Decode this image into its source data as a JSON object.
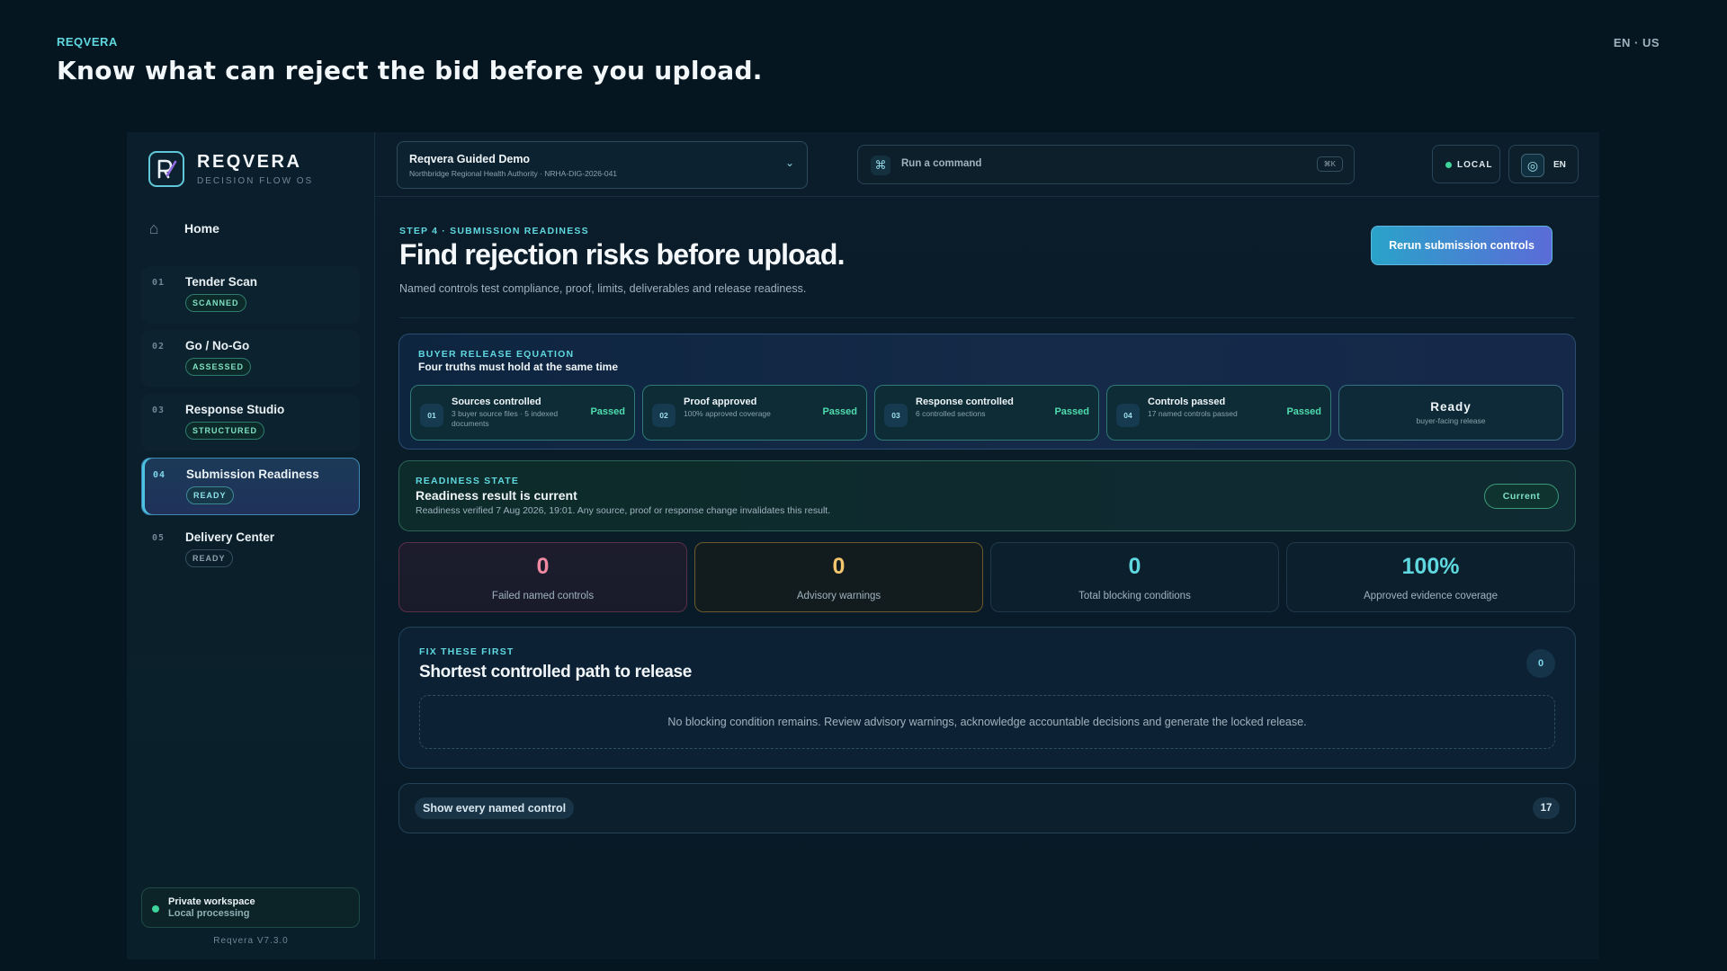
{
  "outer": {
    "brand": "REQVERA",
    "headline": "Know what can reject the bid before you upload.",
    "locale": "EN · US"
  },
  "sidebar": {
    "logo_name": "REQVERA",
    "logo_tagline": "DECISION FLOW OS",
    "home_label": "Home",
    "items": [
      {
        "num": "01",
        "label": "Tender Scan",
        "badge": "SCANNED"
      },
      {
        "num": "02",
        "label": "Go / No-Go",
        "badge": "ASSESSED"
      },
      {
        "num": "03",
        "label": "Response Studio",
        "badge": "STRUCTURED"
      },
      {
        "num": "04",
        "label": "Submission Readiness",
        "badge": "READY",
        "active": true
      },
      {
        "num": "05",
        "label": "Delivery Center",
        "badge": "READY"
      }
    ],
    "workspace_title": "Private workspace",
    "workspace_sub": "Local processing",
    "version": "Reqvera V7.3.0"
  },
  "topbar": {
    "project_name": "Reqvera Guided Demo",
    "project_sub": "Northbridge Regional Health Authority · NRHA-DIG-2026-041",
    "command_label": "Run a command",
    "command_shortcut": "⌘K",
    "mode_label": "LOCAL",
    "language_label": "EN"
  },
  "header": {
    "step": "STEP 4 · SUBMISSION READINESS",
    "title": "Find rejection risks before upload.",
    "subtitle": "Named controls test compliance, proof, limits, deliverables and release readiness.",
    "rerun_label": "Rerun submission controls"
  },
  "equation": {
    "eyebrow": "BUYER RELEASE EQUATION",
    "title": "Four truths must hold at the same time",
    "items": [
      {
        "num": "01",
        "name": "Sources controlled",
        "desc": "3 buyer source files · 5 indexed documents",
        "status": "Passed"
      },
      {
        "num": "02",
        "name": "Proof approved",
        "desc": "100% approved coverage",
        "status": "Passed"
      },
      {
        "num": "03",
        "name": "Response controlled",
        "desc": "6 controlled sections",
        "status": "Passed"
      },
      {
        "num": "04",
        "name": "Controls passed",
        "desc": "17 named controls passed",
        "status": "Passed"
      }
    ],
    "result_title": "Ready",
    "result_sub": "buyer-facing release"
  },
  "state": {
    "eyebrow": "READINESS STATE",
    "title": "Readiness result is current",
    "text": "Readiness verified 7 Aug 2026, 19:01. Any source, proof or response change invalidates this result.",
    "badge": "Current"
  },
  "metrics": [
    {
      "value": "0",
      "label": "Failed named controls",
      "color": "#f08aa2"
    },
    {
      "value": "0",
      "label": "Advisory warnings",
      "color": "#f2c66d"
    },
    {
      "value": "0",
      "label": "Total blocking conditions",
      "color": "#5fd8e0"
    },
    {
      "value": "100%",
      "label": "Approved evidence coverage",
      "color": "#5fd8e0"
    }
  ],
  "fix": {
    "eyebrow": "FIX THESE FIRST",
    "title": "Shortest controlled path to release",
    "count": "0",
    "empty_text": "No blocking condition remains. Review advisory warnings, acknowledge accountable decisions and generate the locked release."
  },
  "controls": {
    "toggle_label": "Show every named control",
    "count": "17"
  },
  "colors": {
    "accent": "#5fd8e0",
    "passed": "#4fdcae",
    "background": "#051620"
  }
}
